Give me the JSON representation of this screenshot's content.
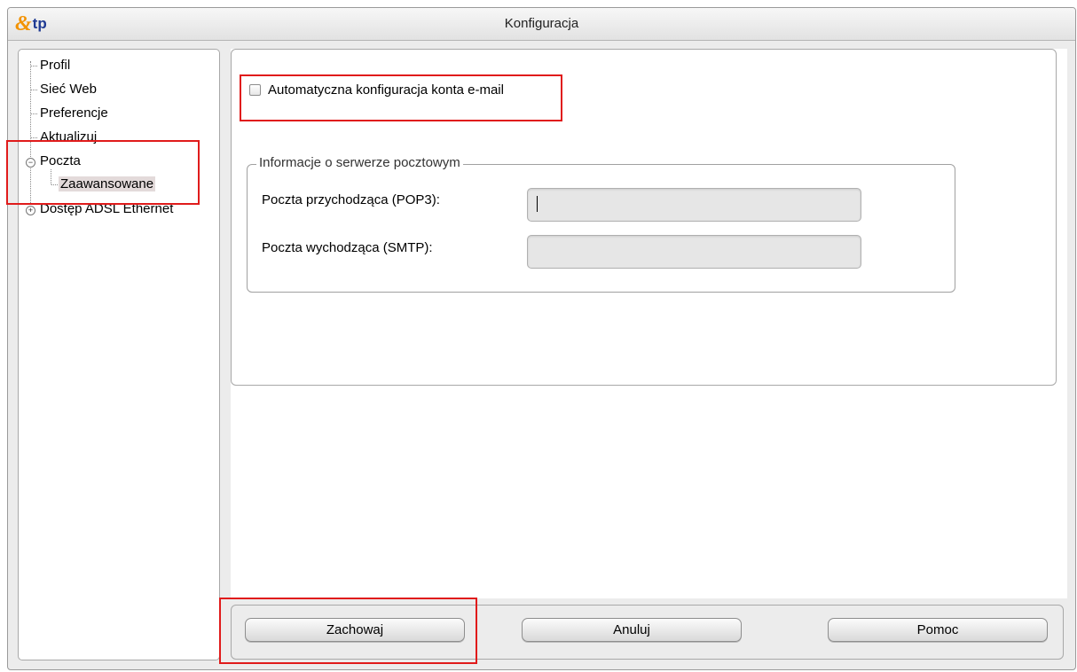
{
  "window": {
    "title": "Konfiguracja",
    "logo_text": "tp"
  },
  "sidebar": {
    "items": [
      {
        "label": "Profil"
      },
      {
        "label": "Sieć Web"
      },
      {
        "label": "Preferencje"
      },
      {
        "label": "Aktualizuj"
      },
      {
        "label": "Poczta",
        "expanded": true
      },
      {
        "label": "Zaawansowane",
        "selected": true
      },
      {
        "label": "Dostęp ADSL Ethernet",
        "expanded": false
      }
    ]
  },
  "main": {
    "auto_config_label": "Automatyczna konfiguracja konta e-mail",
    "auto_config_checked": false,
    "group_title": "Informacje o serwerze pocztowym",
    "incoming_label": "Poczta przychodząca (POP3):",
    "incoming_value": "",
    "outgoing_label": "Poczta wychodząca (SMTP):",
    "outgoing_value": ""
  },
  "buttons": {
    "save": "Zachowaj",
    "cancel": "Anuluj",
    "help": "Pomoc"
  },
  "colors": {
    "highlight": "#e01b1b",
    "selection": "#e3dada",
    "logo_orange": "#f39200",
    "logo_blue": "#1f3a93"
  }
}
